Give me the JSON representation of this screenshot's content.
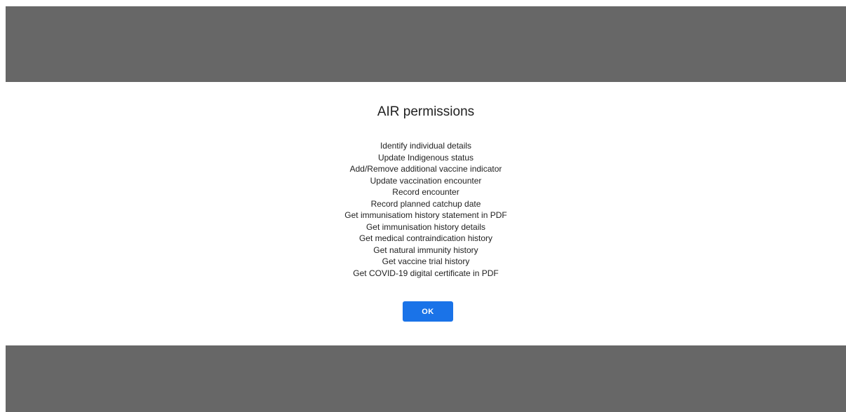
{
  "dialog": {
    "title": "AIR permissions",
    "permissions": [
      "Identify individual details",
      "Update Indigenous status",
      "Add/Remove additional vaccine indicator",
      "Update vaccination encounter",
      "Record encounter",
      "Record planned catchup date",
      "Get immunisatiom history statement in PDF",
      "Get immunisation history details",
      "Get medical contraindication history",
      "Get natural immunity history",
      "Get vaccine trial history",
      "Get COVID-19 digital certificate in PDF"
    ],
    "ok_label": "OK"
  },
  "colors": {
    "overlay": "#676767",
    "primary_button": "#1a73e8",
    "background": "#ffffff"
  }
}
